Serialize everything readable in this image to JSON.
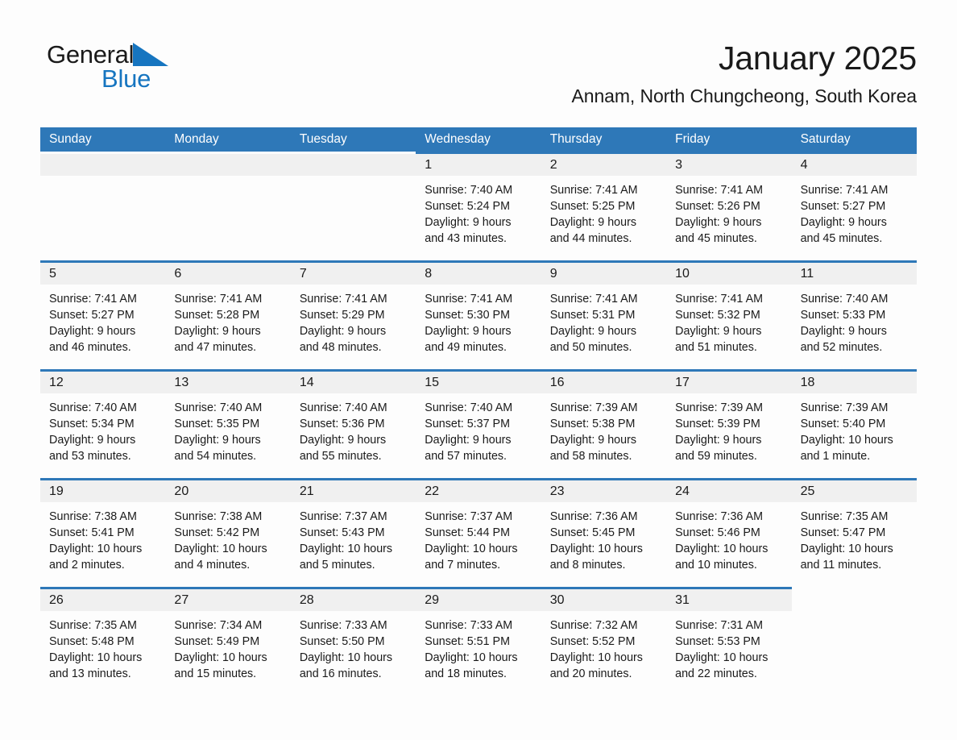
{
  "brand": {
    "name_part1": "General",
    "name_part2": "Blue",
    "triangle_color": "#1675c0"
  },
  "header": {
    "month_title": "January 2025",
    "location": "Annam, North Chungcheong, South Korea",
    "header_bg_color": "#2e78b8",
    "row_rule_color": "#2e78b8",
    "date_strip_color": "#f0f0f0"
  },
  "weekdays": [
    "Sunday",
    "Monday",
    "Tuesday",
    "Wednesday",
    "Thursday",
    "Friday",
    "Saturday"
  ],
  "weeks": [
    [
      {
        "day": "",
        "lines": []
      },
      {
        "day": "",
        "lines": []
      },
      {
        "day": "",
        "lines": []
      },
      {
        "day": "1",
        "lines": [
          "Sunrise: 7:40 AM",
          "Sunset: 5:24 PM",
          "Daylight: 9 hours",
          "and 43 minutes."
        ]
      },
      {
        "day": "2",
        "lines": [
          "Sunrise: 7:41 AM",
          "Sunset: 5:25 PM",
          "Daylight: 9 hours",
          "and 44 minutes."
        ]
      },
      {
        "day": "3",
        "lines": [
          "Sunrise: 7:41 AM",
          "Sunset: 5:26 PM",
          "Daylight: 9 hours",
          "and 45 minutes."
        ]
      },
      {
        "day": "4",
        "lines": [
          "Sunrise: 7:41 AM",
          "Sunset: 5:27 PM",
          "Daylight: 9 hours",
          "and 45 minutes."
        ]
      }
    ],
    [
      {
        "day": "5",
        "lines": [
          "Sunrise: 7:41 AM",
          "Sunset: 5:27 PM",
          "Daylight: 9 hours",
          "and 46 minutes."
        ]
      },
      {
        "day": "6",
        "lines": [
          "Sunrise: 7:41 AM",
          "Sunset: 5:28 PM",
          "Daylight: 9 hours",
          "and 47 minutes."
        ]
      },
      {
        "day": "7",
        "lines": [
          "Sunrise: 7:41 AM",
          "Sunset: 5:29 PM",
          "Daylight: 9 hours",
          "and 48 minutes."
        ]
      },
      {
        "day": "8",
        "lines": [
          "Sunrise: 7:41 AM",
          "Sunset: 5:30 PM",
          "Daylight: 9 hours",
          "and 49 minutes."
        ]
      },
      {
        "day": "9",
        "lines": [
          "Sunrise: 7:41 AM",
          "Sunset: 5:31 PM",
          "Daylight: 9 hours",
          "and 50 minutes."
        ]
      },
      {
        "day": "10",
        "lines": [
          "Sunrise: 7:41 AM",
          "Sunset: 5:32 PM",
          "Daylight: 9 hours",
          "and 51 minutes."
        ]
      },
      {
        "day": "11",
        "lines": [
          "Sunrise: 7:40 AM",
          "Sunset: 5:33 PM",
          "Daylight: 9 hours",
          "and 52 minutes."
        ]
      }
    ],
    [
      {
        "day": "12",
        "lines": [
          "Sunrise: 7:40 AM",
          "Sunset: 5:34 PM",
          "Daylight: 9 hours",
          "and 53 minutes."
        ]
      },
      {
        "day": "13",
        "lines": [
          "Sunrise: 7:40 AM",
          "Sunset: 5:35 PM",
          "Daylight: 9 hours",
          "and 54 minutes."
        ]
      },
      {
        "day": "14",
        "lines": [
          "Sunrise: 7:40 AM",
          "Sunset: 5:36 PM",
          "Daylight: 9 hours",
          "and 55 minutes."
        ]
      },
      {
        "day": "15",
        "lines": [
          "Sunrise: 7:40 AM",
          "Sunset: 5:37 PM",
          "Daylight: 9 hours",
          "and 57 minutes."
        ]
      },
      {
        "day": "16",
        "lines": [
          "Sunrise: 7:39 AM",
          "Sunset: 5:38 PM",
          "Daylight: 9 hours",
          "and 58 minutes."
        ]
      },
      {
        "day": "17",
        "lines": [
          "Sunrise: 7:39 AM",
          "Sunset: 5:39 PM",
          "Daylight: 9 hours",
          "and 59 minutes."
        ]
      },
      {
        "day": "18",
        "lines": [
          "Sunrise: 7:39 AM",
          "Sunset: 5:40 PM",
          "Daylight: 10 hours",
          "and 1 minute."
        ]
      }
    ],
    [
      {
        "day": "19",
        "lines": [
          "Sunrise: 7:38 AM",
          "Sunset: 5:41 PM",
          "Daylight: 10 hours",
          "and 2 minutes."
        ]
      },
      {
        "day": "20",
        "lines": [
          "Sunrise: 7:38 AM",
          "Sunset: 5:42 PM",
          "Daylight: 10 hours",
          "and 4 minutes."
        ]
      },
      {
        "day": "21",
        "lines": [
          "Sunrise: 7:37 AM",
          "Sunset: 5:43 PM",
          "Daylight: 10 hours",
          "and 5 minutes."
        ]
      },
      {
        "day": "22",
        "lines": [
          "Sunrise: 7:37 AM",
          "Sunset: 5:44 PM",
          "Daylight: 10 hours",
          "and 7 minutes."
        ]
      },
      {
        "day": "23",
        "lines": [
          "Sunrise: 7:36 AM",
          "Sunset: 5:45 PM",
          "Daylight: 10 hours",
          "and 8 minutes."
        ]
      },
      {
        "day": "24",
        "lines": [
          "Sunrise: 7:36 AM",
          "Sunset: 5:46 PM",
          "Daylight: 10 hours",
          "and 10 minutes."
        ]
      },
      {
        "day": "25",
        "lines": [
          "Sunrise: 7:35 AM",
          "Sunset: 5:47 PM",
          "Daylight: 10 hours",
          "and 11 minutes."
        ]
      }
    ],
    [
      {
        "day": "26",
        "lines": [
          "Sunrise: 7:35 AM",
          "Sunset: 5:48 PM",
          "Daylight: 10 hours",
          "and 13 minutes."
        ]
      },
      {
        "day": "27",
        "lines": [
          "Sunrise: 7:34 AM",
          "Sunset: 5:49 PM",
          "Daylight: 10 hours",
          "and 15 minutes."
        ]
      },
      {
        "day": "28",
        "lines": [
          "Sunrise: 7:33 AM",
          "Sunset: 5:50 PM",
          "Daylight: 10 hours",
          "and 16 minutes."
        ]
      },
      {
        "day": "29",
        "lines": [
          "Sunrise: 7:33 AM",
          "Sunset: 5:51 PM",
          "Daylight: 10 hours",
          "and 18 minutes."
        ]
      },
      {
        "day": "30",
        "lines": [
          "Sunrise: 7:32 AM",
          "Sunset: 5:52 PM",
          "Daylight: 10 hours",
          "and 20 minutes."
        ]
      },
      {
        "day": "31",
        "lines": [
          "Sunrise: 7:31 AM",
          "Sunset: 5:53 PM",
          "Daylight: 10 hours",
          "and 22 minutes."
        ]
      },
      {
        "day": "",
        "lines": []
      }
    ]
  ]
}
